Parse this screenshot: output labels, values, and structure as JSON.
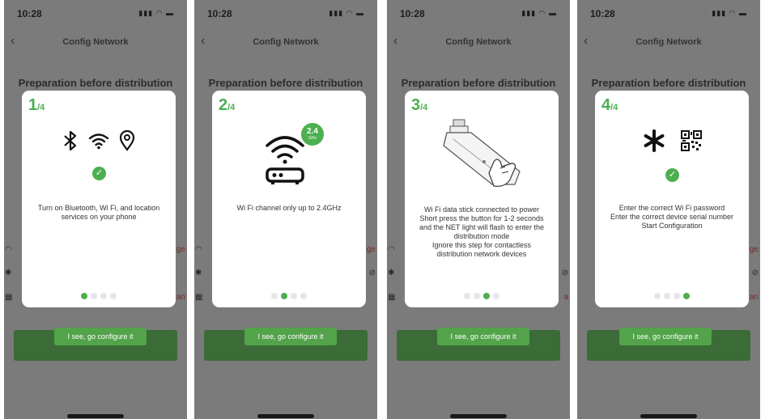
{
  "status_time": "10:28",
  "nav_title": "Config Network",
  "bg_heading": "Preparation before distribution",
  "confirm_label": "I see, go configure it",
  "step_total": "/4",
  "bg_right_1": "ge",
  "bg_right_2": "an",
  "bg_right_3": "a",
  "wifi_badge": "2.4",
  "wifi_badge_unit": "GHz",
  "steps": [
    {
      "number": "1",
      "description": "Turn on Bluetooth, Wi Fi, and location\nservices on your phone"
    },
    {
      "number": "2",
      "description": "Wi Fi channel only up to 2.4GHz"
    },
    {
      "number": "3",
      "description": "Wi Fi data stick connected to power\nShort press the button for 1-2 seconds\nand the NET light will flash to enter the\ndistribution mode\nIgnore this step for contactless\ndistribution network devices"
    },
    {
      "number": "4",
      "description": "Enter the correct Wi Fi password\nEnter the correct device serial number\nStart Configuration"
    }
  ],
  "colors": {
    "accent": "#4caf50",
    "button": "#52a34a",
    "overlay": "#7b7b7b"
  }
}
